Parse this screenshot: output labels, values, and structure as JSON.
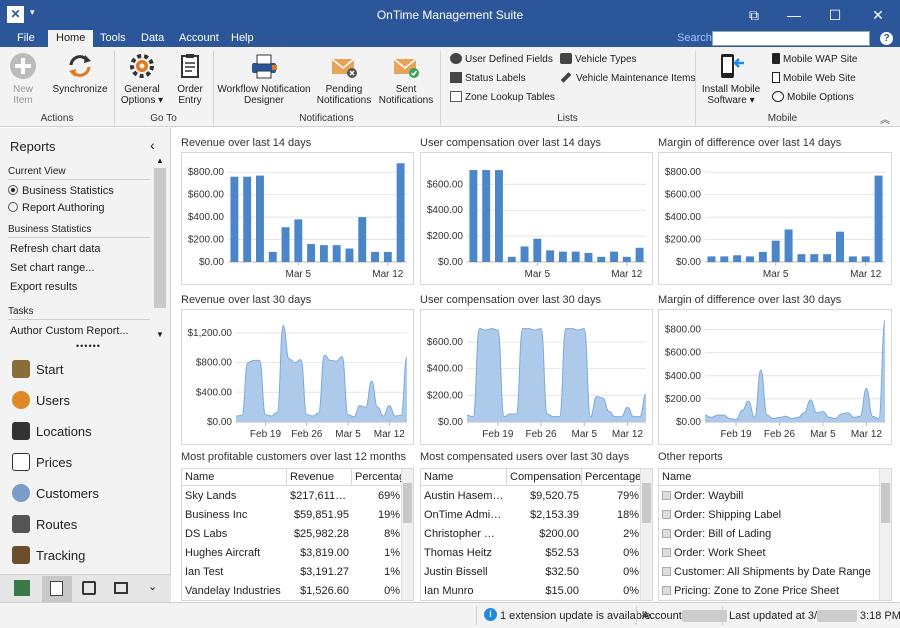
{
  "window": {
    "title": "OnTime Management Suite"
  },
  "menu": {
    "tabs": [
      "File",
      "Home",
      "Tools",
      "Data",
      "Account",
      "Help"
    ],
    "active": "Home",
    "search_label": "Search:",
    "help": "?"
  },
  "ribbon": {
    "new_item": "New Item",
    "synchronize": "Synchronize",
    "general_options": "General Options ▾",
    "order_entry": "Order Entry",
    "workflow_designer": "Workflow Notification Designer",
    "pending_notifications": "Pending Notifications",
    "sent_notifications": "Sent Notifications",
    "user_defined_fields": "User Defined Fields",
    "status_labels": "Status Labels",
    "zone_lookup_tables": "Zone Lookup Tables",
    "vehicle_types": "Vehicle Types",
    "vehicle_maintenance": "Vehicle Maintenance Items",
    "install_mobile": "Install Mobile Software ▾",
    "mobile_wap": "Mobile WAP Site",
    "mobile_web": "Mobile Web Site",
    "mobile_options": "Mobile Options",
    "groups": {
      "actions": "Actions",
      "goto": "Go To",
      "notifications": "Notifications",
      "lists": "Lists",
      "mobile": "Mobile"
    }
  },
  "sidebar": {
    "header": "Reports",
    "current_view": "Current View",
    "views": [
      "Business Statistics",
      "Report Authoring"
    ],
    "business_statistics": "Business Statistics",
    "stat_links": [
      "Refresh chart data",
      "Set chart range...",
      "Export results"
    ],
    "tasks": "Tasks",
    "task_links": [
      "Author Custom Report..."
    ],
    "nav": [
      "Start",
      "Users",
      "Locations",
      "Prices",
      "Customers",
      "Routes",
      "Tracking"
    ]
  },
  "charts": {
    "rev14": {
      "title": "Revenue over last 14 days"
    },
    "comp14": {
      "title": "User compensation over last 14 days"
    },
    "margin14": {
      "title": "Margin of difference over last 14 days"
    },
    "rev30": {
      "title": "Revenue over last 30 days"
    },
    "comp30": {
      "title": "User compensation over last 30 days"
    },
    "margin30": {
      "title": "Margin of difference over last 30 days"
    }
  },
  "chart_data": [
    {
      "type": "bar",
      "id": "rev14",
      "title": "Revenue over last 14 days",
      "ylim": [
        0,
        900
      ],
      "yticks": [
        "$0.00",
        "$200.00",
        "$400.00",
        "$600.00",
        "$800.00"
      ],
      "ytickvals": [
        0,
        200,
        400,
        600,
        800
      ],
      "xticks": [
        "Mar 5",
        "Mar 12"
      ],
      "xtickidx": [
        5,
        12
      ],
      "values": [
        760,
        760,
        770,
        90,
        310,
        380,
        160,
        150,
        150,
        120,
        400,
        90,
        90,
        880
      ]
    },
    {
      "type": "bar",
      "id": "comp14",
      "title": "User compensation over last 14 days",
      "ylim": [
        0,
        780
      ],
      "yticks": [
        "$0.00",
        "$200.00",
        "$400.00",
        "$600.00"
      ],
      "ytickvals": [
        0,
        200,
        400,
        600
      ],
      "xticks": [
        "Mar 5",
        "Mar 12"
      ],
      "xtickidx": [
        5,
        12
      ],
      "values": [
        710,
        710,
        710,
        40,
        120,
        180,
        90,
        80,
        80,
        70,
        40,
        80,
        40,
        110
      ]
    },
    {
      "type": "bar",
      "id": "margin14",
      "title": "Margin of difference over last 14 days",
      "ylim": [
        0,
        900
      ],
      "yticks": [
        "$0.00",
        "$200.00",
        "$400.00",
        "$600.00",
        "$800.00"
      ],
      "ytickvals": [
        0,
        200,
        400,
        600,
        800
      ],
      "xticks": [
        "Mar 5",
        "Mar 12"
      ],
      "xtickidx": [
        5,
        12
      ],
      "values": [
        50,
        50,
        60,
        50,
        90,
        190,
        290,
        70,
        70,
        70,
        270,
        50,
        50,
        770
      ]
    },
    {
      "type": "area",
      "id": "rev30",
      "title": "Revenue over last 30 days",
      "ylim": [
        0,
        1400
      ],
      "yticks": [
        "$0.00",
        "$400.00",
        "$800.00",
        "$1,200.00"
      ],
      "ytickvals": [
        0,
        400,
        800,
        1200
      ],
      "xticks": [
        "Feb 19",
        "Feb 26",
        "Mar 5",
        "Mar 12"
      ],
      "xtickidx": [
        5,
        12,
        19,
        26
      ],
      "values": [
        80,
        90,
        800,
        830,
        830,
        100,
        80,
        130,
        1300,
        850,
        800,
        840,
        100,
        80,
        120,
        900,
        830,
        820,
        880,
        100,
        70,
        220,
        200,
        550,
        200,
        80,
        220,
        80,
        90,
        880
      ]
    },
    {
      "type": "area",
      "id": "comp30",
      "title": "User compensation over last 30 days",
      "ylim": [
        0,
        780
      ],
      "yticks": [
        "$0.00",
        "$200.00",
        "$400.00",
        "$600.00"
      ],
      "ytickvals": [
        0,
        200,
        400,
        600
      ],
      "xticks": [
        "Feb 19",
        "Feb 26",
        "Mar 5",
        "Mar 12"
      ],
      "xtickidx": [
        5,
        12,
        19,
        26
      ],
      "values": [
        50,
        40,
        700,
        690,
        700,
        690,
        40,
        60,
        60,
        700,
        700,
        690,
        700,
        60,
        40,
        40,
        700,
        700,
        690,
        700,
        40,
        190,
        180,
        80,
        40,
        40,
        110,
        40,
        40,
        210
      ]
    },
    {
      "type": "area",
      "id": "margin30",
      "title": "Margin of difference over last 30 days",
      "ylim": [
        0,
        900
      ],
      "yticks": [
        "$0.00",
        "$200.00",
        "$400.00",
        "$600.00",
        "$800.00"
      ],
      "ytickvals": [
        0,
        200,
        400,
        600,
        800
      ],
      "xticks": [
        "Feb 19",
        "Feb 26",
        "Mar 5",
        "Mar 12"
      ],
      "xtickidx": [
        5,
        12,
        19,
        26
      ],
      "values": [
        60,
        40,
        60,
        60,
        30,
        20,
        100,
        180,
        40,
        450,
        60,
        30,
        40,
        50,
        30,
        40,
        80,
        190,
        80,
        90,
        40,
        30,
        70,
        80,
        40,
        50,
        290,
        50,
        30,
        880
      ]
    }
  ],
  "tables": {
    "customers": {
      "title": "Most profitable customers over last 12 months",
      "columns": [
        "Name",
        "Revenue",
        "Percentage"
      ],
      "rows": [
        [
          "Sky Lands",
          "$217,611.86",
          "69%"
        ],
        [
          "Business Inc",
          "$59,851.95",
          "19%"
        ],
        [
          "DS Labs",
          "$25,982.28",
          "8%"
        ],
        [
          "Hughes Aircraft",
          "$3,819.00",
          "1%"
        ],
        [
          "Ian Test",
          "$3,191.27",
          "1%"
        ],
        [
          "Vandelay Industries",
          "$1,526.60",
          "0%"
        ]
      ]
    },
    "users": {
      "title": "Most compensated users over last 30 days",
      "columns": [
        "Name",
        "Compensation",
        "Percentage"
      ],
      "rows": [
        [
          "Austin Hasemey...",
          "$9,520.75",
          "79%"
        ],
        [
          "OnTime Admini...",
          "$2,153.39",
          "18%"
        ],
        [
          "Christopher Wa...",
          "$200.00",
          "2%"
        ],
        [
          "Thomas Heitz",
          "$52.53",
          "0%"
        ],
        [
          "Justin Bissell",
          "$32.50",
          "0%"
        ],
        [
          "Ian Munro",
          "$15.00",
          "0%"
        ]
      ]
    },
    "other": {
      "title": "Other reports",
      "columns": [
        "Name"
      ],
      "rows": [
        "Order: Waybill",
        "Order: Shipping Label",
        "Order: Bill of Lading",
        "Order: Work Sheet",
        "Customer: All Shipments by Date Range",
        "Pricing: Zone to Zone Price Sheet"
      ]
    }
  },
  "status": {
    "extension": "1 extension update is available.",
    "account_label": "Account:",
    "account_value": "VESSEO",
    "updated_prefix": "Last updated at 3/",
    "updated_blur": "13/2017",
    "updated_time": " 3:18 PM"
  }
}
